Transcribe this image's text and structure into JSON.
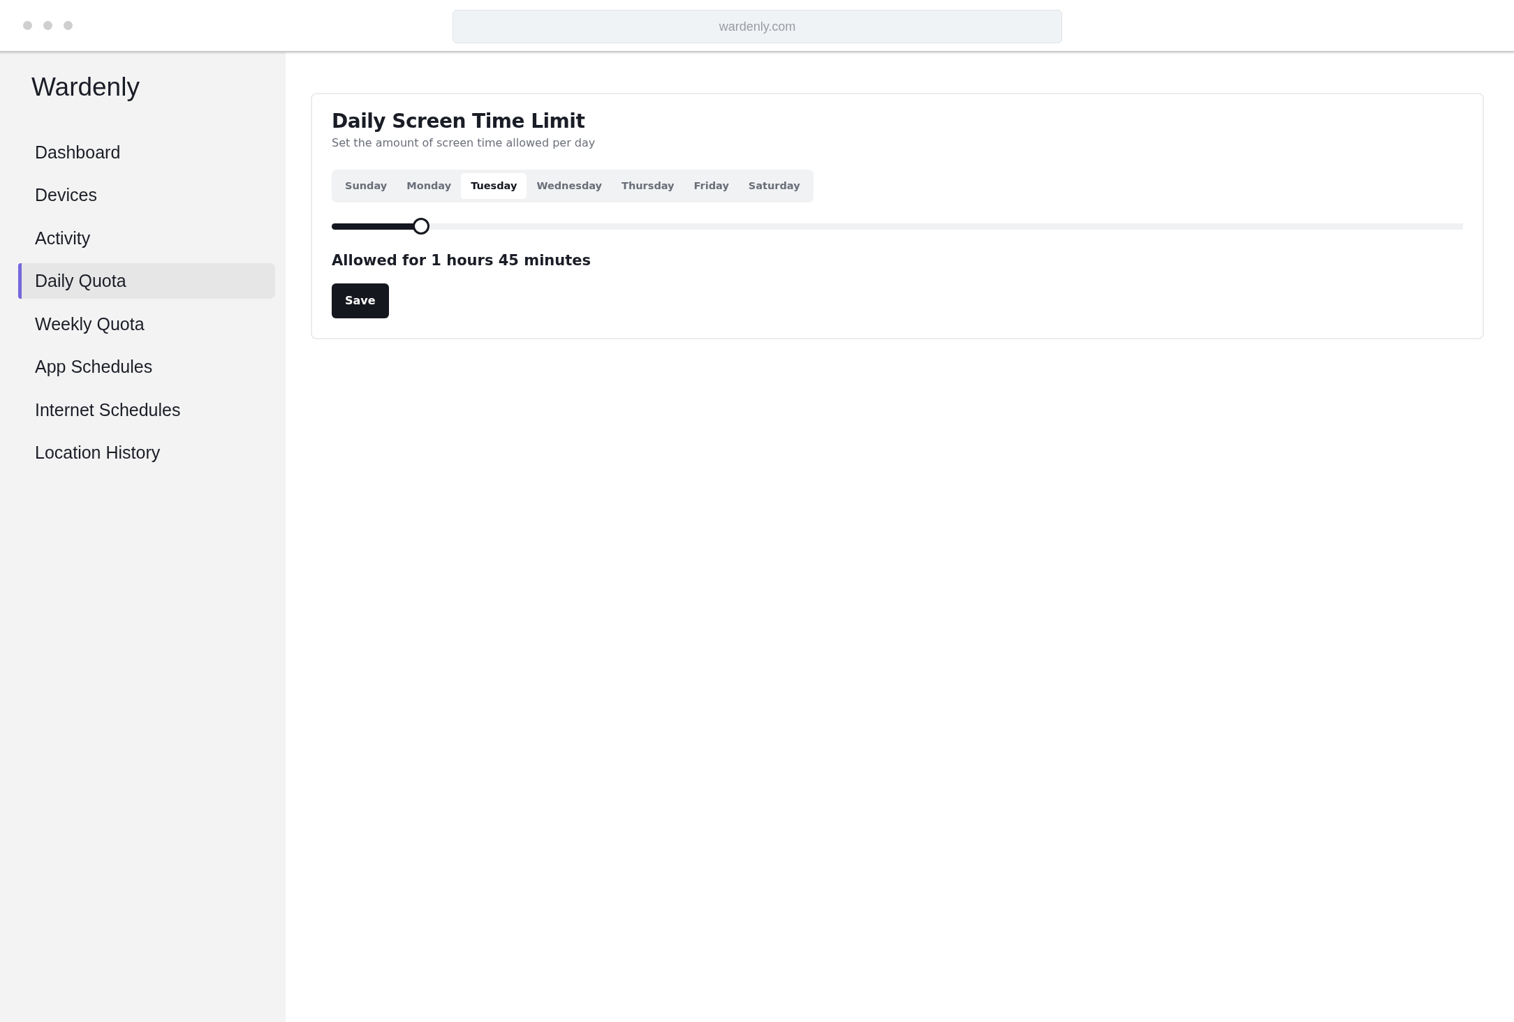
{
  "browser": {
    "url": "wardenly.com"
  },
  "sidebar": {
    "logo": "Wardenly",
    "items": [
      {
        "label": "Dashboard",
        "selected": false
      },
      {
        "label": "Devices",
        "selected": false
      },
      {
        "label": "Activity",
        "selected": false
      },
      {
        "label": "Daily Quota",
        "selected": true
      },
      {
        "label": "Weekly Quota",
        "selected": false
      },
      {
        "label": "App Schedules",
        "selected": false
      },
      {
        "label": "Internet Schedules",
        "selected": false
      },
      {
        "label": "Location History",
        "selected": false
      }
    ]
  },
  "card": {
    "title": "Daily Screen Time Limit",
    "subtitle": "Set the amount of screen time allowed per day",
    "tabs": [
      {
        "label": "Sunday",
        "selected": false
      },
      {
        "label": "Monday",
        "selected": false
      },
      {
        "label": "Tuesday",
        "selected": true
      },
      {
        "label": "Wednesday",
        "selected": false
      },
      {
        "label": "Thursday",
        "selected": false
      },
      {
        "label": "Friday",
        "selected": false
      },
      {
        "label": "Saturday",
        "selected": false
      }
    ],
    "slider": {
      "level": 0.079
    },
    "summary": "Allowed for 1 hours 45 minutes",
    "save_button": "Save"
  }
}
